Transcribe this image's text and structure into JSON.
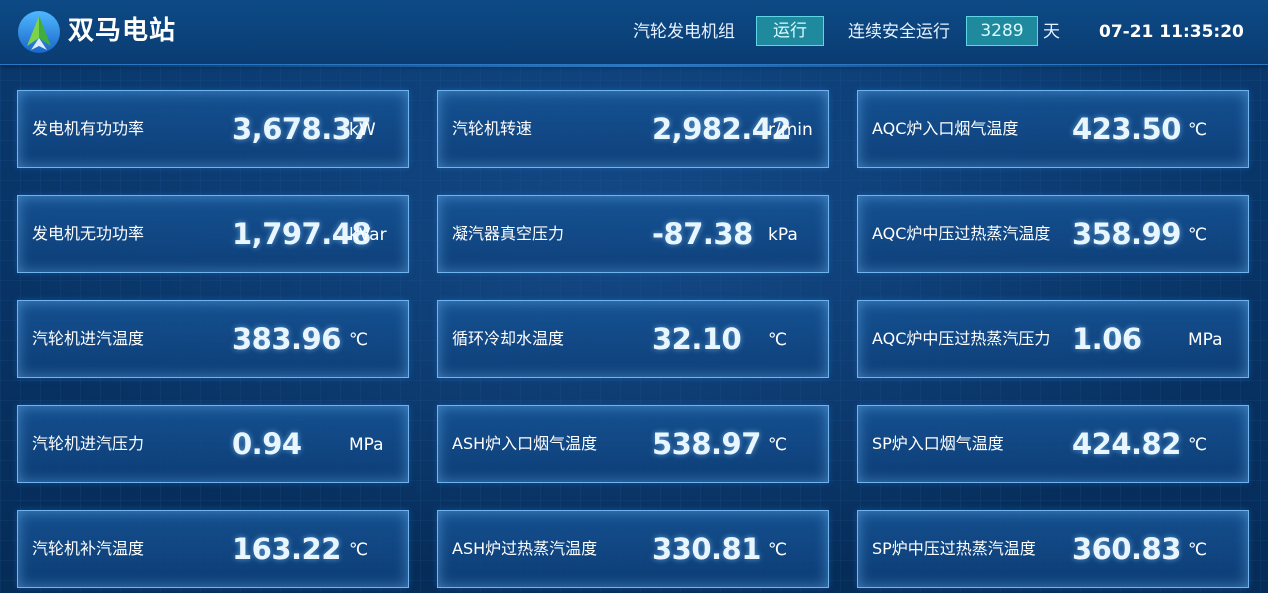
{
  "header": {
    "station_name": "双马电站",
    "unit_label": "汽轮发电机组",
    "unit_status": "运行",
    "safe_run_label": "连续安全运行",
    "safe_run_days": "3289",
    "days_unit": "天",
    "datetime": "07-21 11:35:20"
  },
  "colors": {
    "background": "#06305e",
    "card_border": "#6fb4ee",
    "status_badge": "#1f8a9e"
  },
  "metrics": {
    "col1": [
      {
        "label": "发电机有功功率",
        "value": "3,678.37",
        "unit": "kW"
      },
      {
        "label": "发电机无功功率",
        "value": "1,797.48",
        "unit": "kVar"
      },
      {
        "label": "汽轮机进汽温度",
        "value": "383.96",
        "unit": "℃"
      },
      {
        "label": "汽轮机进汽压力",
        "value": "0.94",
        "unit": "MPa"
      },
      {
        "label": "汽轮机补汽温度",
        "value": "163.22",
        "unit": "℃"
      }
    ],
    "col2": [
      {
        "label": "汽轮机转速",
        "value": "2,982.42",
        "unit": "r/min"
      },
      {
        "label": "凝汽器真空压力",
        "value": "-87.38",
        "unit": "kPa"
      },
      {
        "label": "循环冷却水温度",
        "value": "32.10",
        "unit": "℃"
      },
      {
        "label": "ASH炉入口烟气温度",
        "value": "538.97",
        "unit": "℃"
      },
      {
        "label": "ASH炉过热蒸汽温度",
        "value": "330.81",
        "unit": "℃"
      }
    ],
    "col3": [
      {
        "label": "AQC炉入口烟气温度",
        "value": "423.50",
        "unit": "℃"
      },
      {
        "label": "AQC炉中压过热蒸汽温度",
        "value": "358.99",
        "unit": "℃"
      },
      {
        "label": "AQC炉中压过热蒸汽压力",
        "value": "1.06",
        "unit": "MPa"
      },
      {
        "label": "SP炉入口烟气温度",
        "value": "424.82",
        "unit": "℃"
      },
      {
        "label": "SP炉中压过热蒸汽温度",
        "value": "360.83",
        "unit": "℃"
      }
    ]
  }
}
